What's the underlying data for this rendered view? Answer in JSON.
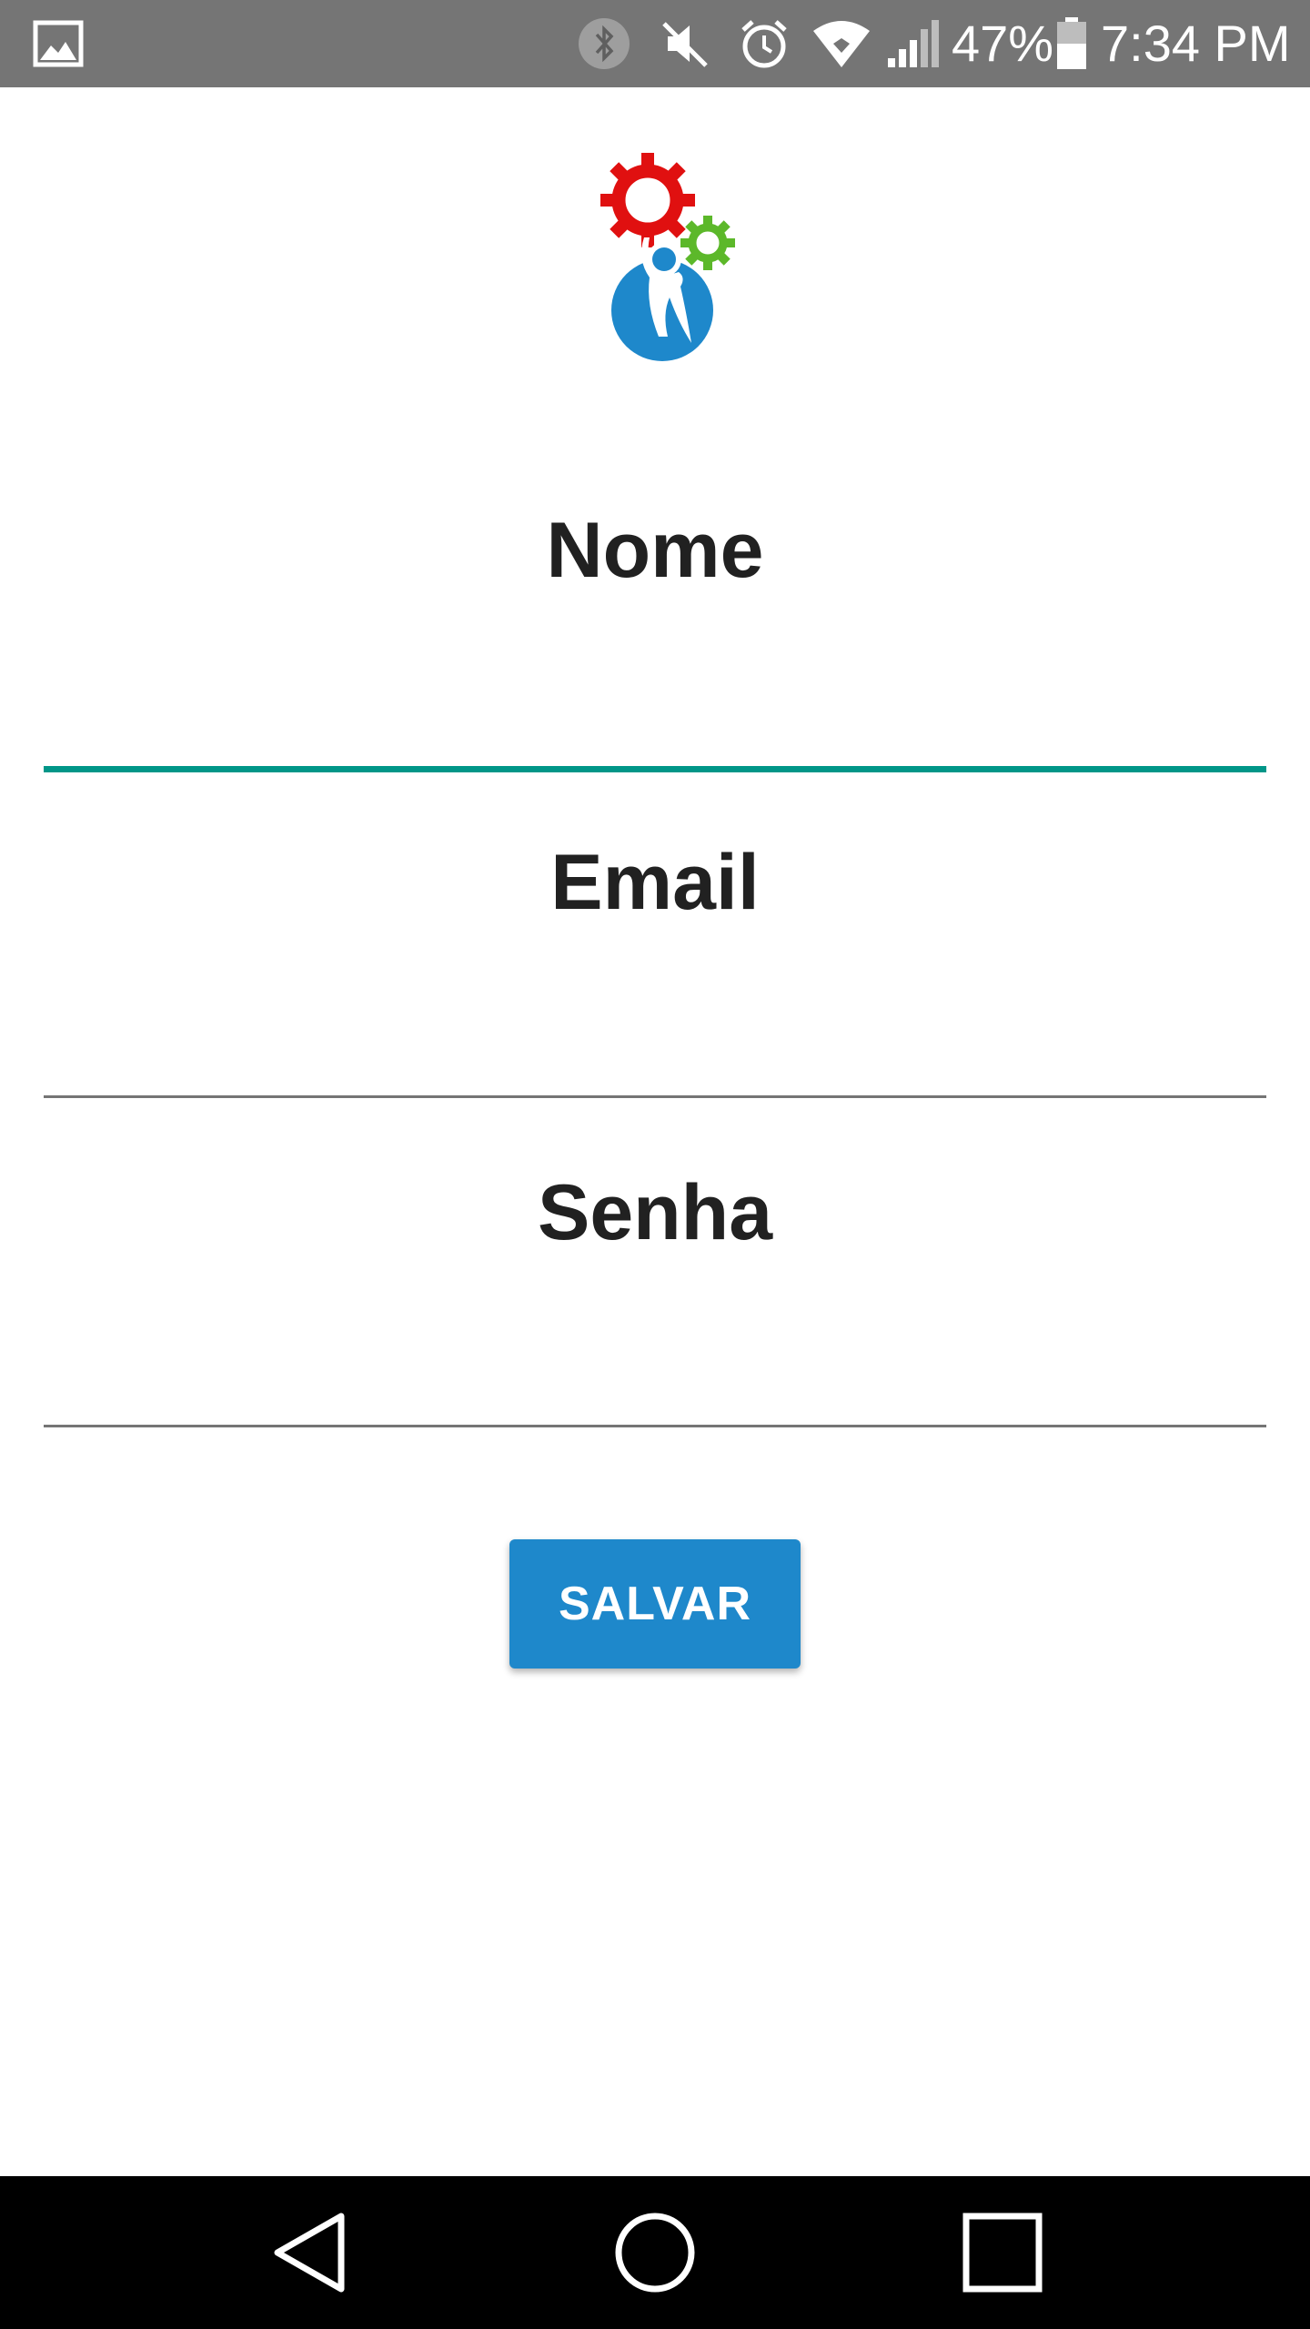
{
  "status_bar": {
    "battery_percent": "47%",
    "time": "7:34 PM",
    "icons": [
      "gallery-notification-icon",
      "bluetooth-icon",
      "mute-icon",
      "alarm-icon",
      "wifi-icon",
      "signal-icon",
      "battery-icon"
    ]
  },
  "logo": {
    "icon": "gears-person-logo",
    "colors": {
      "big_gear": "#e01010",
      "small_gear": "#5cb82a",
      "figure_circle": "#1e88cb"
    }
  },
  "form": {
    "fields": [
      {
        "label": "Nome",
        "value": "",
        "state": "focused"
      },
      {
        "label": "Email",
        "value": "",
        "state": "normal"
      },
      {
        "label": "Senha",
        "value": "",
        "state": "normal"
      }
    ],
    "save_label": "SALVAR"
  },
  "colors": {
    "accent": "#009688",
    "button": "#1e88cb",
    "status_bar": "#757575",
    "nav_bar": "#000000"
  },
  "nav_bar": {
    "icons": [
      "back-icon",
      "home-icon",
      "recents-icon"
    ]
  }
}
